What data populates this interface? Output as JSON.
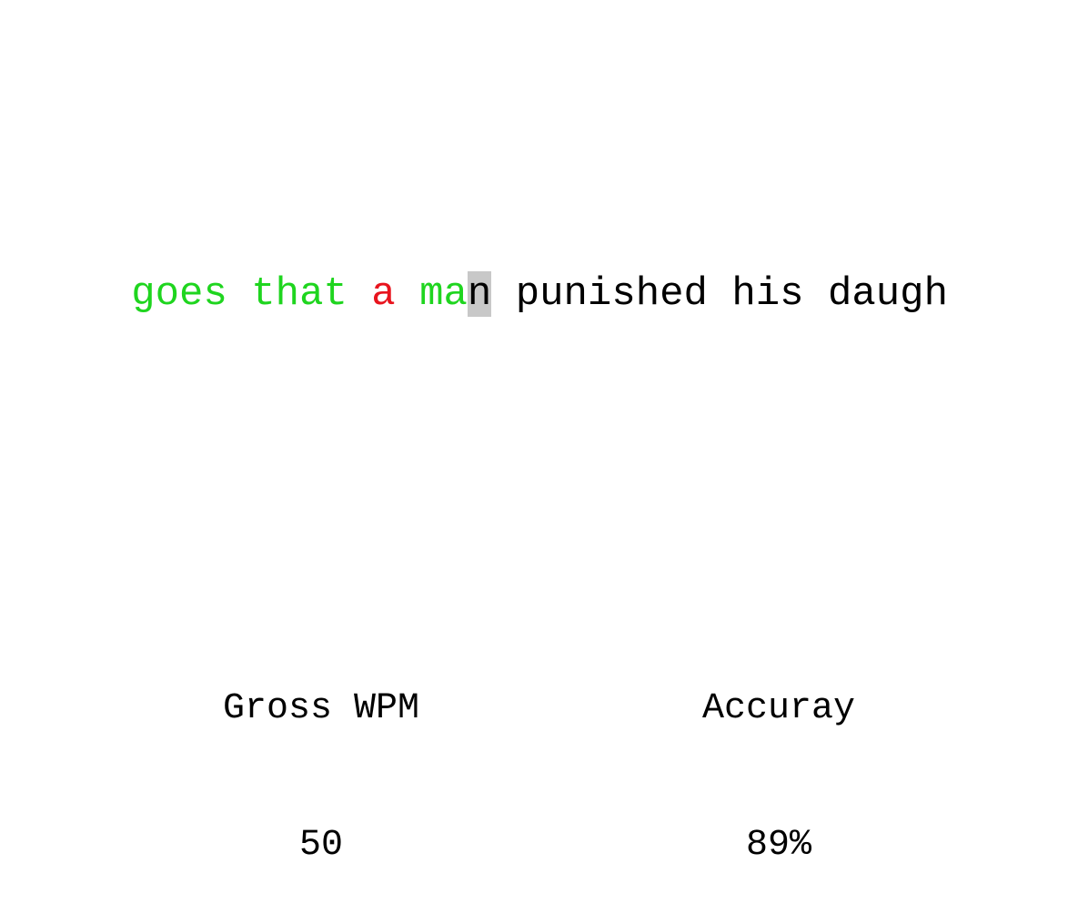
{
  "typing": {
    "typed_correct_1": "goes that ",
    "typed_error": "a",
    "space_after_error": " ",
    "typed_correct_2": "ma",
    "cursor_char": "n",
    "remaining": " punished his daugh",
    "colors": {
      "correct": "#1fd51f",
      "error": "#e8141e",
      "cursor_bg": "#c8c8c8",
      "pending": "#000000"
    }
  },
  "stats": {
    "wpm_label": "Gross WPM",
    "wpm_value": "50",
    "accuracy_label": "Accuray",
    "accuracy_value": "89%"
  }
}
